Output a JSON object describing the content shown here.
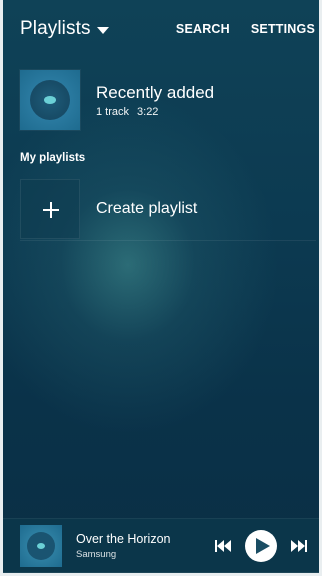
{
  "header": {
    "title": "Playlists",
    "search_label": "SEARCH",
    "settings_label": "SETTINGS"
  },
  "recent": {
    "title": "Recently added",
    "tracks": "1 track",
    "duration": "3:22"
  },
  "sections": {
    "my_playlists": "My playlists"
  },
  "create": {
    "label": "Create playlist"
  },
  "player": {
    "title": "Over the Horizon",
    "artist": "Samsung"
  },
  "icons": {
    "dropdown": "caret-down-icon",
    "plus": "plus-icon",
    "prev": "skip-previous-icon",
    "play": "play-icon",
    "next": "skip-next-icon"
  },
  "colors": {
    "background": "#0c3a51",
    "accent": "#6bd0d6",
    "text": "#ffffff"
  }
}
